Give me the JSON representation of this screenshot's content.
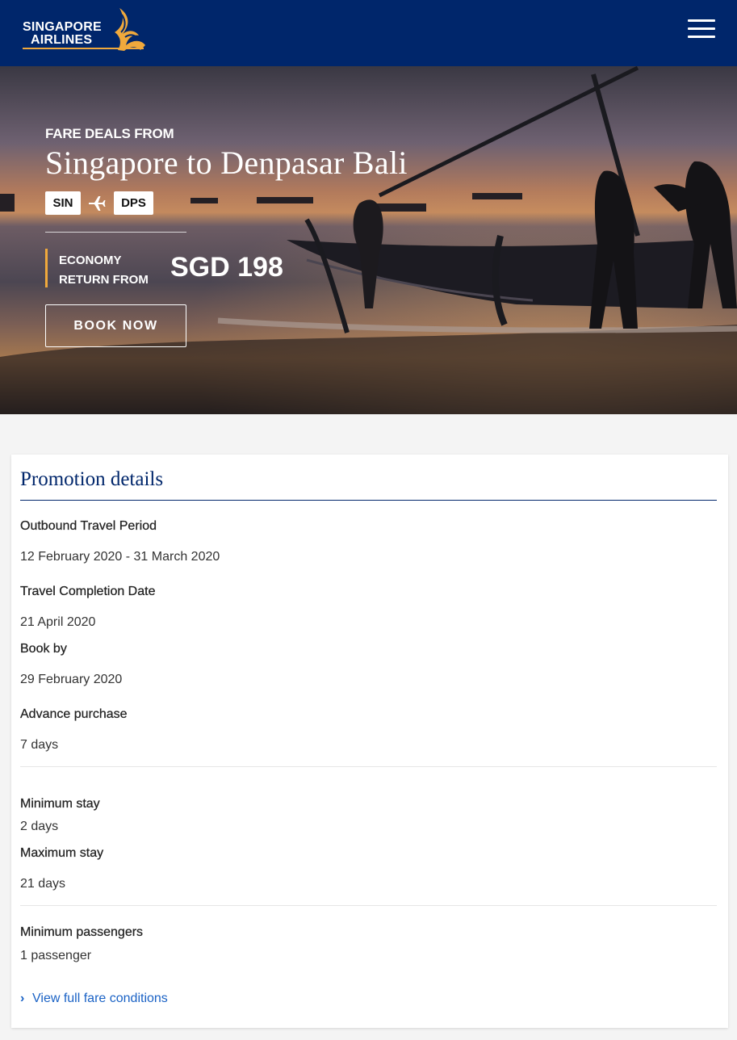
{
  "header": {
    "logo": {
      "line1": "SINGAPORE",
      "line2": "AIRLINES"
    },
    "icons": {
      "logo": "kris-bird-logo",
      "menu": "hamburger-menu-icon"
    },
    "colors": {
      "brand_navy": "#00266b",
      "brand_gold": "#f0a93c"
    }
  },
  "hero": {
    "eyebrow": "FARE DEALS FROM",
    "title": "Singapore to Denpasar Bali",
    "origin_code": "SIN",
    "destination_code": "DPS",
    "route_icon": "plane-icon",
    "fare_label_line1": "ECONOMY",
    "fare_label_line2": "RETURN FROM",
    "fare_price": "SGD 198",
    "book_button": "BOOK NOW"
  },
  "details": {
    "title": "Promotion details",
    "items": [
      {
        "label": "Outbound Travel Period",
        "value": "12 February 2020 - 31 March 2020"
      },
      {
        "label": "Travel Completion Date",
        "value": "21 April 2020"
      },
      {
        "label": "Book by",
        "value": "29 February 2020"
      },
      {
        "label": "Advance purchase",
        "value": "7 days"
      },
      {
        "label": "Minimum stay",
        "value": "2 days"
      },
      {
        "label": "Maximum stay",
        "value": "21 days"
      },
      {
        "label": "Minimum passengers",
        "value": "1 passenger"
      }
    ],
    "link": "View full fare conditions",
    "link_icon": "chevron-right-icon",
    "colors": {
      "link": "#1a62c5",
      "title": "#00266b"
    }
  }
}
